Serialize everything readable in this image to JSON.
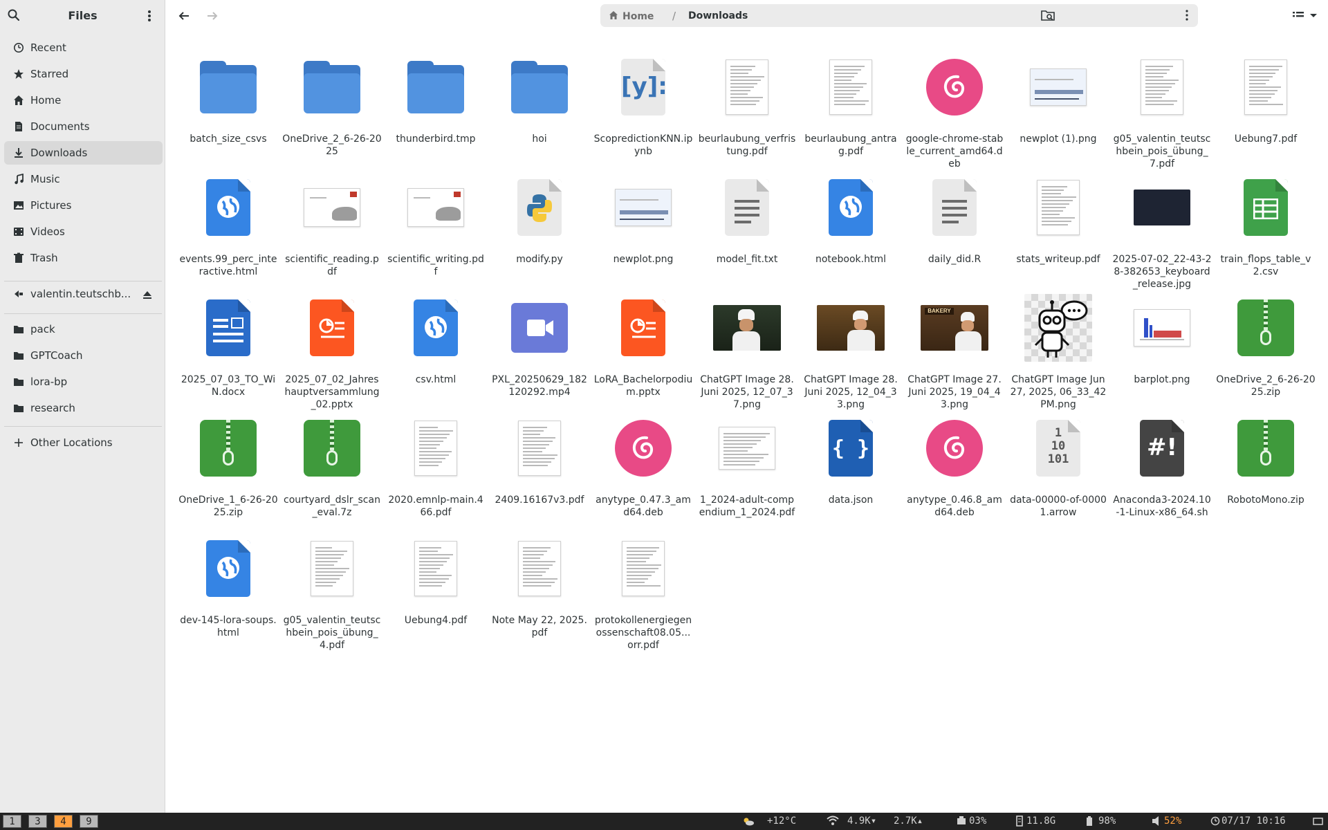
{
  "app": {
    "title": "Files"
  },
  "sidebar": {
    "places": [
      {
        "label": "Recent",
        "icon": "clock-icon"
      },
      {
        "label": "Starred",
        "icon": "star-icon"
      },
      {
        "label": "Home",
        "icon": "home-icon"
      },
      {
        "label": "Documents",
        "icon": "document-icon"
      },
      {
        "label": "Downloads",
        "icon": "download-icon",
        "active": true
      },
      {
        "label": "Music",
        "icon": "music-icon"
      },
      {
        "label": "Pictures",
        "icon": "picture-icon"
      },
      {
        "label": "Videos",
        "icon": "video-icon"
      },
      {
        "label": "Trash",
        "icon": "trash-icon"
      }
    ],
    "network": {
      "label": "valentin.teutschb...",
      "icon": "network-share-icon"
    },
    "bookmarks": [
      {
        "label": "pack"
      },
      {
        "label": "GPTCoach"
      },
      {
        "label": "lora-bp"
      },
      {
        "label": "research"
      }
    ],
    "other_locations": "Other Locations"
  },
  "pathbar": {
    "home": "Home",
    "separator": "/",
    "current": "Downloads"
  },
  "files": [
    {
      "name": "batch_size_csvs",
      "kind": "folder"
    },
    {
      "name": "OneDrive_2_6-26-2025",
      "kind": "folder"
    },
    {
      "name": "thunderbird.tmp",
      "kind": "folder"
    },
    {
      "name": "hoi",
      "kind": "folder"
    },
    {
      "name": "ScopredictionKNN.ipynb",
      "kind": "ipynb"
    },
    {
      "name": "beurlaubung_verfristung.pdf",
      "kind": "pdf-thumb"
    },
    {
      "name": "beurlaubung_antrag.pdf",
      "kind": "pdf-thumb"
    },
    {
      "name": "google-chrome-stable_current_amd64.deb",
      "kind": "deb"
    },
    {
      "name": "newplot (1).png",
      "kind": "plot-thumb"
    },
    {
      "name": "g05_valentin_teutschbein_pois_übung_7.pdf",
      "kind": "pdf-thumb"
    },
    {
      "name": "Uebung7.pdf",
      "kind": "pdf-thumb"
    },
    {
      "name": "events.99_perc_interactive.html",
      "kind": "html"
    },
    {
      "name": "scientific_reading.pdf",
      "kind": "slide-thumb"
    },
    {
      "name": "scientific_writing.pdf",
      "kind": "slide-thumb"
    },
    {
      "name": "modify.py",
      "kind": "python"
    },
    {
      "name": "newplot.png",
      "kind": "plot-thumb"
    },
    {
      "name": "model_fit.txt",
      "kind": "text"
    },
    {
      "name": "notebook.html",
      "kind": "html"
    },
    {
      "name": "daily_did.R",
      "kind": "text"
    },
    {
      "name": "stats_writeup.pdf",
      "kind": "pdf-thumb"
    },
    {
      "name": "2025-07-02_22-43-28-382653_keyboard_release.jpg",
      "kind": "dark-thumb"
    },
    {
      "name": "train_flops_table_v2.csv",
      "kind": "csv"
    },
    {
      "name": "2025_07_03_TO_WiN.docx",
      "kind": "docx"
    },
    {
      "name": "2025_07_02_Jahreshauptversammlung_02.pptx",
      "kind": "pptx"
    },
    {
      "name": "csv.html",
      "kind": "html"
    },
    {
      "name": "PXL_20250629_182120292.mp4",
      "kind": "video"
    },
    {
      "name": "LoRA_Bachelorpodium.pptx",
      "kind": "pptx"
    },
    {
      "name": "ChatGPT Image 28. Juni 2025, 12_07_37.png",
      "kind": "photo-a"
    },
    {
      "name": "ChatGPT Image 28. Juni 2025, 12_04_33.png",
      "kind": "photo-b"
    },
    {
      "name": "ChatGPT Image 27. Juni 2025, 19_04_43.png",
      "kind": "photo-c"
    },
    {
      "name": "ChatGPT Image Jun 27, 2025, 06_33_42 PM.png",
      "kind": "robot"
    },
    {
      "name": "barplot.png",
      "kind": "barplot-thumb"
    },
    {
      "name": "OneDrive_2_6-26-2025.zip",
      "kind": "zip"
    },
    {
      "name": "OneDrive_1_6-26-2025.zip",
      "kind": "zip"
    },
    {
      "name": "courtyard_dslr_scan_eval.7z",
      "kind": "zip"
    },
    {
      "name": "2020.emnlp-main.466.pdf",
      "kind": "pdf-thumb"
    },
    {
      "name": "2409.16167v3.pdf",
      "kind": "pdf-thumb"
    },
    {
      "name": "anytype_0.47.3_amd64.deb",
      "kind": "deb"
    },
    {
      "name": "1_2024-adult-compendium_1_2024.pdf",
      "kind": "table-thumb"
    },
    {
      "name": "data.json",
      "kind": "json"
    },
    {
      "name": "anytype_0.46.8_amd64.deb",
      "kind": "deb"
    },
    {
      "name": "data-00000-of-00001.arrow",
      "kind": "binary"
    },
    {
      "name": "Anaconda3-2024.10-1-Linux-x86_64.sh",
      "kind": "script"
    },
    {
      "name": "RobotoMono.zip",
      "kind": "zip"
    },
    {
      "name": "dev-145-lora-soups.html",
      "kind": "html"
    },
    {
      "name": "g05_valentin_teutschbein_pois_übung_4.pdf",
      "kind": "pdf-thumb"
    },
    {
      "name": "Uebung4.pdf",
      "kind": "pdf-thumb"
    },
    {
      "name": "Note May 22, 2025.pdf",
      "kind": "pdf-thumb"
    },
    {
      "name": "protokollenergiegenossenschaft08.05...orr.pdf",
      "kind": "pdf-thumb"
    }
  ],
  "statusbar": {
    "workspaces": [
      "1",
      "3",
      "4",
      "9"
    ],
    "active_workspace": "4",
    "weather": "+12°C",
    "net_down": "4.9K",
    "net_up": "2.7K",
    "cpu": "03%",
    "memory": "11.8G",
    "battery": "98%",
    "volume": "52%",
    "datetime": "07/17 10:16"
  },
  "colors": {
    "folder": "#5293e0",
    "html": "#3584e4",
    "deb": "#e84a86",
    "zip": "#3f9a3c",
    "pptx": "#fc5621",
    "accent_workspace": "#ff9f3f",
    "volume": "#ff9f3f"
  }
}
